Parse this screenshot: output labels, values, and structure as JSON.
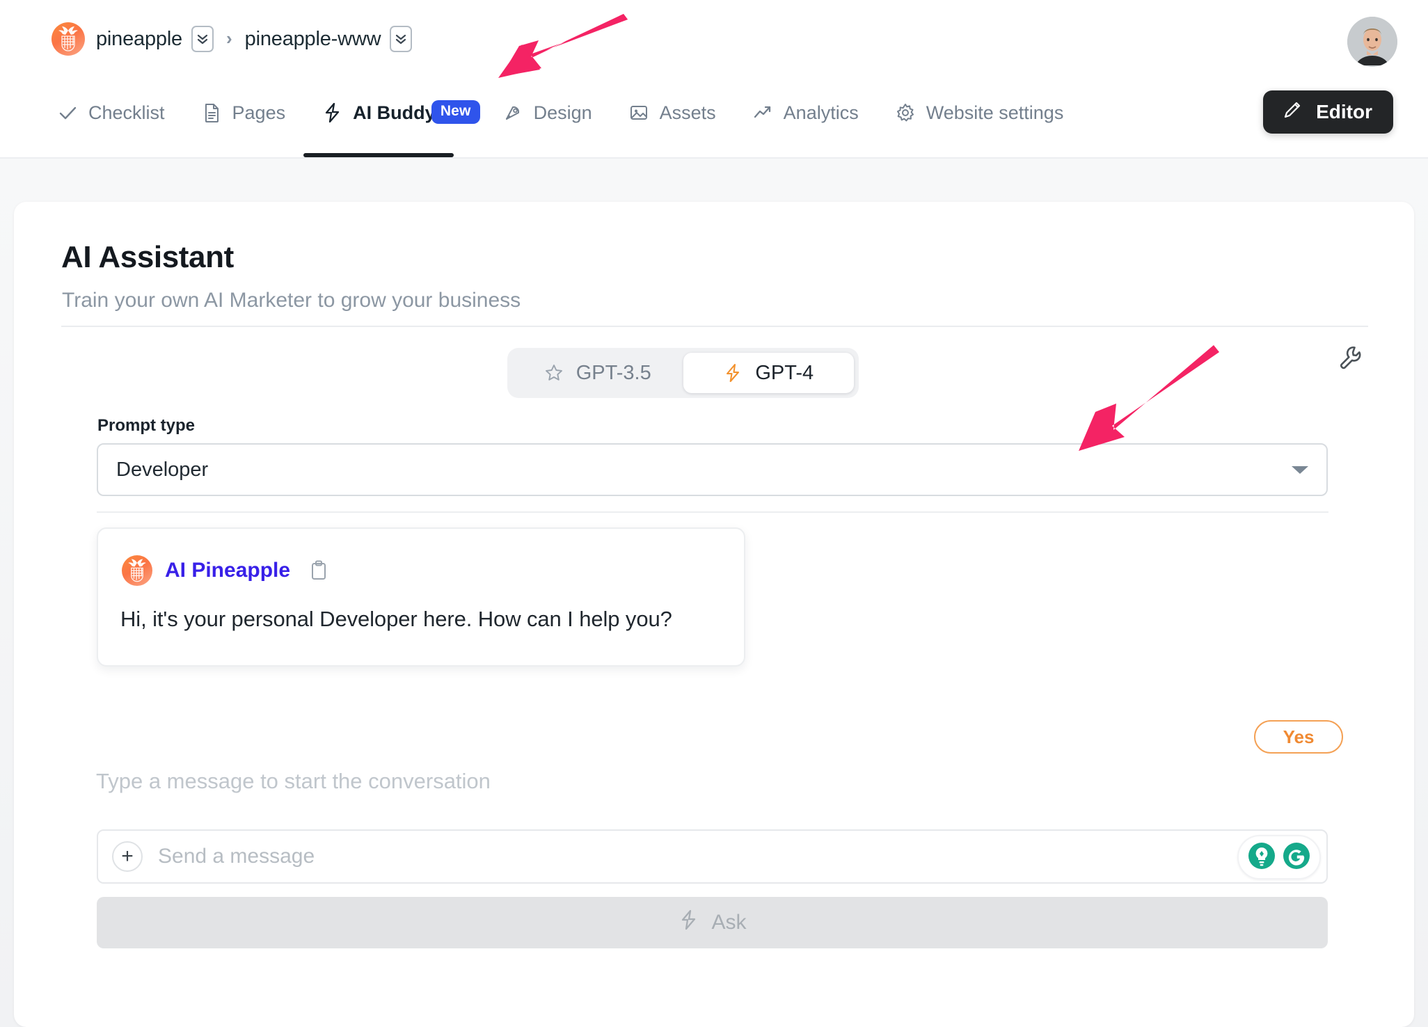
{
  "colors": {
    "accent_orange": "#F08A33",
    "brand_blue": "#2F54EB",
    "link_blue": "#3820E8",
    "annotation_pink": "#F42364",
    "grammarly_green": "#15A98A",
    "text_dark": "#14191F",
    "text_muted": "#8C97A3"
  },
  "breadcrumb": {
    "workspace": "pineapple",
    "workspace_icon": "pineapple-logo-icon",
    "separator": "›",
    "site": "pineapple-www",
    "switch_icon": "double-chevron-down-icon"
  },
  "nav": {
    "tabs": [
      {
        "label": "Checklist",
        "icon": "check-icon",
        "active": false,
        "badge": null
      },
      {
        "label": "Pages",
        "icon": "document-icon",
        "active": false,
        "badge": null
      },
      {
        "label": "AI Buddy",
        "icon": "lightning-bolt-icon",
        "active": true,
        "badge": "New"
      },
      {
        "label": "Design",
        "icon": "pen-nib-icon",
        "active": false,
        "badge": null
      },
      {
        "label": "Assets",
        "icon": "image-icon",
        "active": false,
        "badge": null
      },
      {
        "label": "Analytics",
        "icon": "trend-up-icon",
        "active": false,
        "badge": null
      },
      {
        "label": "Website settings",
        "icon": "gear-icon",
        "active": false,
        "badge": null
      }
    ],
    "editor_button": {
      "label": "Editor",
      "icon": "pencil-icon"
    },
    "avatar": {
      "icon": "user-avatar-photo"
    }
  },
  "panel": {
    "title": "AI Assistant",
    "subtitle": "Train your own AI Marketer to grow your business",
    "settings_icon": "wrench-icon",
    "model_toggle": {
      "options": [
        {
          "label": "GPT-3.5",
          "icon": "star-icon",
          "selected": false
        },
        {
          "label": "GPT-4",
          "icon": "lightning-bolt-icon",
          "selected": true
        }
      ],
      "selected": "GPT-4"
    },
    "prompt_type": {
      "label": "Prompt type",
      "value": "Developer",
      "caret_icon": "chevron-down-icon"
    },
    "conversation": [
      {
        "author": "AI Pineapple",
        "author_icon": "pineapple-logo-icon",
        "copy_icon": "clipboard-copy-icon",
        "text": "Hi, it's your personal Developer here. How can I help you?"
      }
    ],
    "quick_replies": [
      {
        "label": "Yes"
      }
    ],
    "hint": "Type a message to start the conversation",
    "message_input": {
      "placeholder": "Send a message",
      "value": "",
      "attach_icon": "plus-circle-icon",
      "assist_icons": [
        "grammarly-lightbulb-icon",
        "grammarly-logo-icon"
      ]
    },
    "ask_button": {
      "label": "Ask",
      "icon": "lightning-bolt-icon",
      "disabled": true
    }
  },
  "annotations": [
    {
      "name": "arrow-to-ai-buddy-tab",
      "color": "#F42364",
      "points_to": "AI Buddy tab"
    },
    {
      "name": "arrow-to-prompt-type-select",
      "color": "#F42364",
      "points_to": "Prompt type dropdown"
    }
  ]
}
